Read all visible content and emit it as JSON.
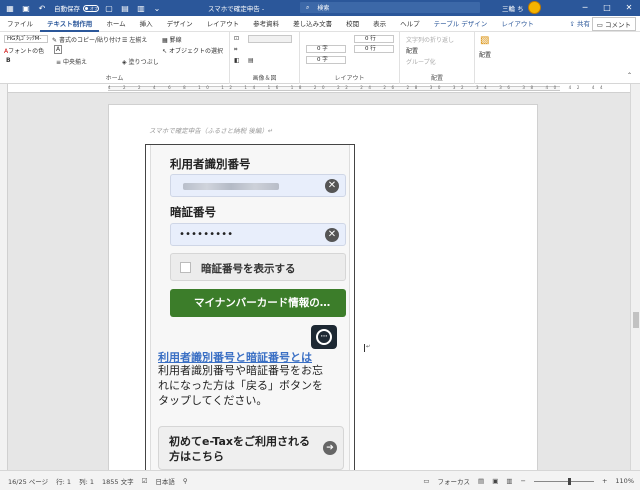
{
  "titlebar": {
    "autosave_label": "自動保存",
    "autosave_state": "オフ",
    "doc_title": "スマホで確定申告 -",
    "search_placeholder": "検索",
    "user_name": "三輪 ち",
    "window_buttons": [
      "─",
      "□",
      "✕"
    ]
  },
  "tabs": [
    "ファイル",
    "テキスト制作用",
    "ホーム",
    "挿入",
    "デザイン",
    "レイアウト",
    "参考資料",
    "差し込み文書",
    "校閲",
    "表示",
    "ヘルプ",
    "テーブル デザイン",
    "レイアウト"
  ],
  "share_label": "共有",
  "comment_label": "コメント",
  "ribbon": {
    "home": {
      "label": "ホーム",
      "font_name": "HG丸ｺﾞｼｯｸM-",
      "font_color": "フォントの色",
      "format_copy": "書式のコピー/貼り付け",
      "left_align": "左揃え",
      "center_align": "中央揃え",
      "fill": "塗りつぶし",
      "borders": "罫線",
      "select_object": "オブジェクトの選択",
      "bold": "B",
      "a_box": "A"
    },
    "image": {
      "label": "画像＆図"
    },
    "layout": {
      "label": "レイアウト",
      "spacing1": "0 字",
      "spacing2": "0 字",
      "spacing3": "0 行",
      "spacing4": "0 行"
    },
    "arrange": {
      "label": "配置",
      "wrap_text": "文字列の折り返し",
      "position": "配置",
      "group": "グループ化",
      "arrange_btn": "配置"
    }
  },
  "document": {
    "header_text": "スマホで確定申告（ふるさと納税 後編）↵"
  },
  "phone": {
    "user_id_label": "利用者識別番号",
    "pin_label": "暗証番号",
    "pin_value": "•••••••••",
    "show_pin_label": "暗証番号を表示する",
    "mynumber_button": "マイナンバーカード情報の…",
    "clear_glyph": "✕"
  },
  "page_content": {
    "link_text": "利用者識別番号と暗証番号とは",
    "body_lines": [
      "利用者識別番号や暗証番号をお忘",
      "れになった方は「戻る」ボタンを",
      "タップしてください。"
    ],
    "etax_text": "初めてe-Taxをご利用される方はこちら",
    "arrow_glyph": "➔",
    "fab_glyph": "···",
    "cursor_glyph": "↵"
  },
  "ruler_ticks": "4 2 2 4 6 8 10 12 14 16 18 20 22 24 26 28 30 32 34 36 38 40 42 44",
  "statusbar": {
    "page": "16/25 ページ",
    "line": "行: 1",
    "column": "列: 1",
    "words": "1855 文字",
    "language": "日本語",
    "focus": "フォーカス",
    "zoom": "110%"
  },
  "colors": {
    "title_blue": "#2b579a",
    "mynumber_green": "#3c7d2a",
    "link_blue": "#3a6fc4"
  }
}
